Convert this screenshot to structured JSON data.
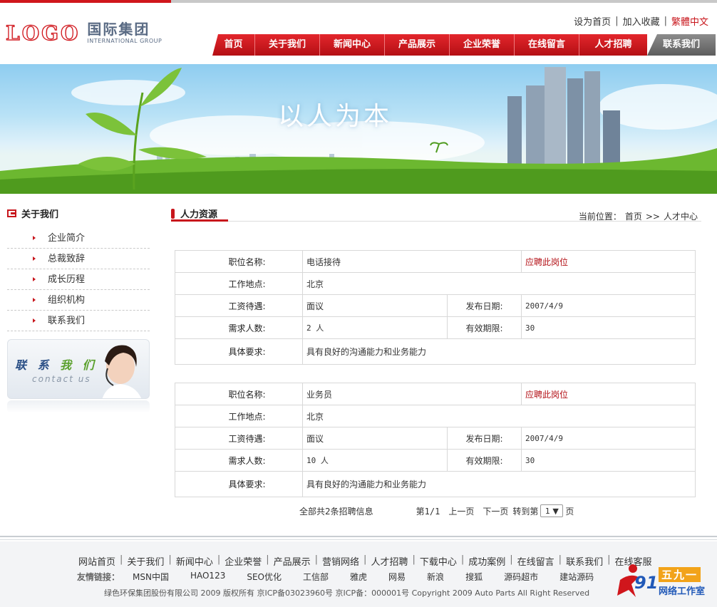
{
  "header": {
    "logo_mark": "LOGO",
    "logo_cn": "国际集团",
    "logo_en": "INTERNATIONAL GROUP",
    "top_links": [
      "设为首页",
      "加入收藏",
      "繁體中文"
    ],
    "nav": [
      "首页",
      "关于我们",
      "新闻中心",
      "产品展示",
      "企业荣誉",
      "在线留言",
      "人才招聘"
    ],
    "nav_last": "联系我们"
  },
  "banner": {
    "title": "以人为本"
  },
  "sidebar": {
    "title": "关于我们",
    "items": [
      "企业简介",
      "总裁致辞",
      "成长历程",
      "组织机构",
      "联系我们"
    ],
    "contact_cn_1": "联 系",
    "contact_cn_2": "我 们",
    "contact_en": "contact us"
  },
  "main": {
    "title": "人力资源",
    "breadcrumb": {
      "prefix": "当前位置：",
      "home": "首页",
      "sep": ">>",
      "current": "人才中心"
    },
    "labels": {
      "position": "职位名称:",
      "location": "工作地点:",
      "salary": "工资待遇:",
      "date": "发布日期:",
      "count": "需求人数:",
      "validity": "有效期限:",
      "requirements": "具体要求:"
    },
    "apply_label": "应聘此岗位",
    "jobs": [
      {
        "position": "电话接待",
        "location": "北京",
        "salary": "面议",
        "date": "2007/4/9",
        "count": "2 人",
        "validity": "30",
        "requirements": "具有良好的沟通能力和业务能力"
      },
      {
        "position": "业务员",
        "location": "北京",
        "salary": "面议",
        "date": "2007/4/9",
        "count": "10 人",
        "validity": "30",
        "requirements": "具有良好的沟通能力和业务能力"
      }
    ],
    "pager": {
      "total": "全部共2条招聘信息",
      "page": "第1/1",
      "prev": "上一页",
      "next": "下一页",
      "goto": "转到第",
      "selected": "1",
      "suffix": "页"
    }
  },
  "footer": {
    "nav": [
      "网站首页",
      "关于我们",
      "新闻中心",
      "企业荣誉",
      "产品展示",
      "营销网络",
      "人才招聘",
      "下载中心",
      "成功案例",
      "在线留言",
      "联系我们",
      "在线客服"
    ],
    "friends_label": "友情链接：",
    "friends": [
      "MSN中国",
      "HAO123",
      "SEO优化",
      "工信部",
      "雅虎",
      "网易",
      "新浪",
      "搜狐",
      "源码超市",
      "建站源码"
    ],
    "copyright": "绿色环保集团股份有限公司 2009 版权所有 京ICP备03023960号 京ICP备：000001号 Copyright 2009 Auto Parts All Right Reserved"
  },
  "watermark": {
    "num": "91",
    "box": "五九一",
    "sub": "网络工作室"
  }
}
